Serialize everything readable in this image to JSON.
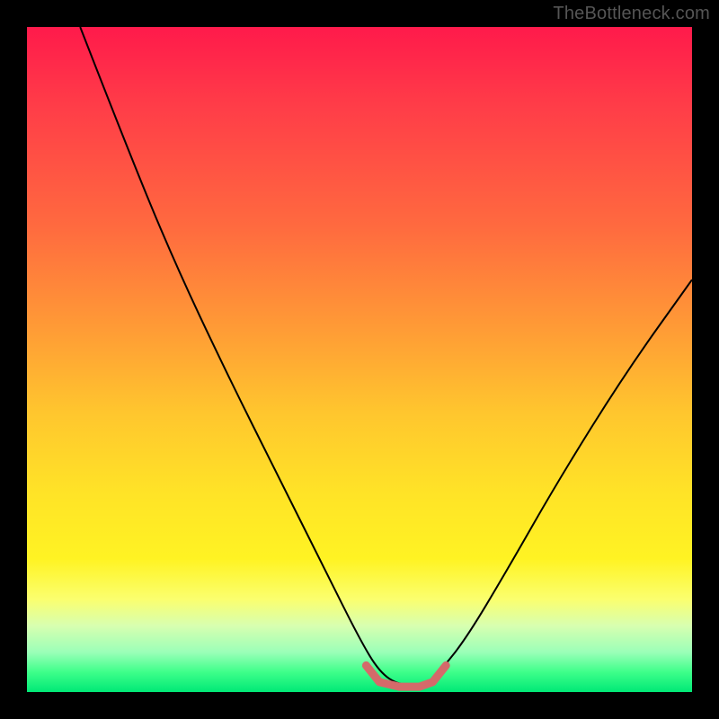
{
  "watermark": "TheBottleneck.com",
  "chart_data": {
    "type": "line",
    "title": "",
    "xlabel": "",
    "ylabel": "",
    "xlim": [
      0,
      100
    ],
    "ylim": [
      0,
      100
    ],
    "gradient_stops": [
      {
        "pos": 0,
        "color": "#ff1a4b"
      },
      {
        "pos": 12,
        "color": "#ff3d48"
      },
      {
        "pos": 30,
        "color": "#ff6a3f"
      },
      {
        "pos": 45,
        "color": "#ff9a36"
      },
      {
        "pos": 58,
        "color": "#ffc62e"
      },
      {
        "pos": 70,
        "color": "#ffe327"
      },
      {
        "pos": 80,
        "color": "#fff323"
      },
      {
        "pos": 86,
        "color": "#fbff6e"
      },
      {
        "pos": 90,
        "color": "#d8ffb0"
      },
      {
        "pos": 94,
        "color": "#9bffb8"
      },
      {
        "pos": 97,
        "color": "#3eff8a"
      },
      {
        "pos": 100,
        "color": "#00e876"
      }
    ],
    "series": [
      {
        "name": "main-curve",
        "color": "#000000",
        "stroke_width": 2,
        "x": [
          8,
          15,
          22,
          30,
          38,
          45,
          50,
          53,
          56,
          60,
          62,
          66,
          72,
          80,
          90,
          100
        ],
        "y": [
          100,
          82,
          65,
          48,
          32,
          18,
          8,
          3,
          1,
          1,
          3,
          8,
          18,
          32,
          48,
          62
        ]
      },
      {
        "name": "valley-highlight",
        "color": "#d46a6a",
        "stroke_width": 9,
        "x": [
          51,
          53,
          56,
          59,
          61,
          63
        ],
        "y": [
          4,
          1.5,
          0.8,
          0.8,
          1.5,
          4
        ]
      }
    ]
  }
}
